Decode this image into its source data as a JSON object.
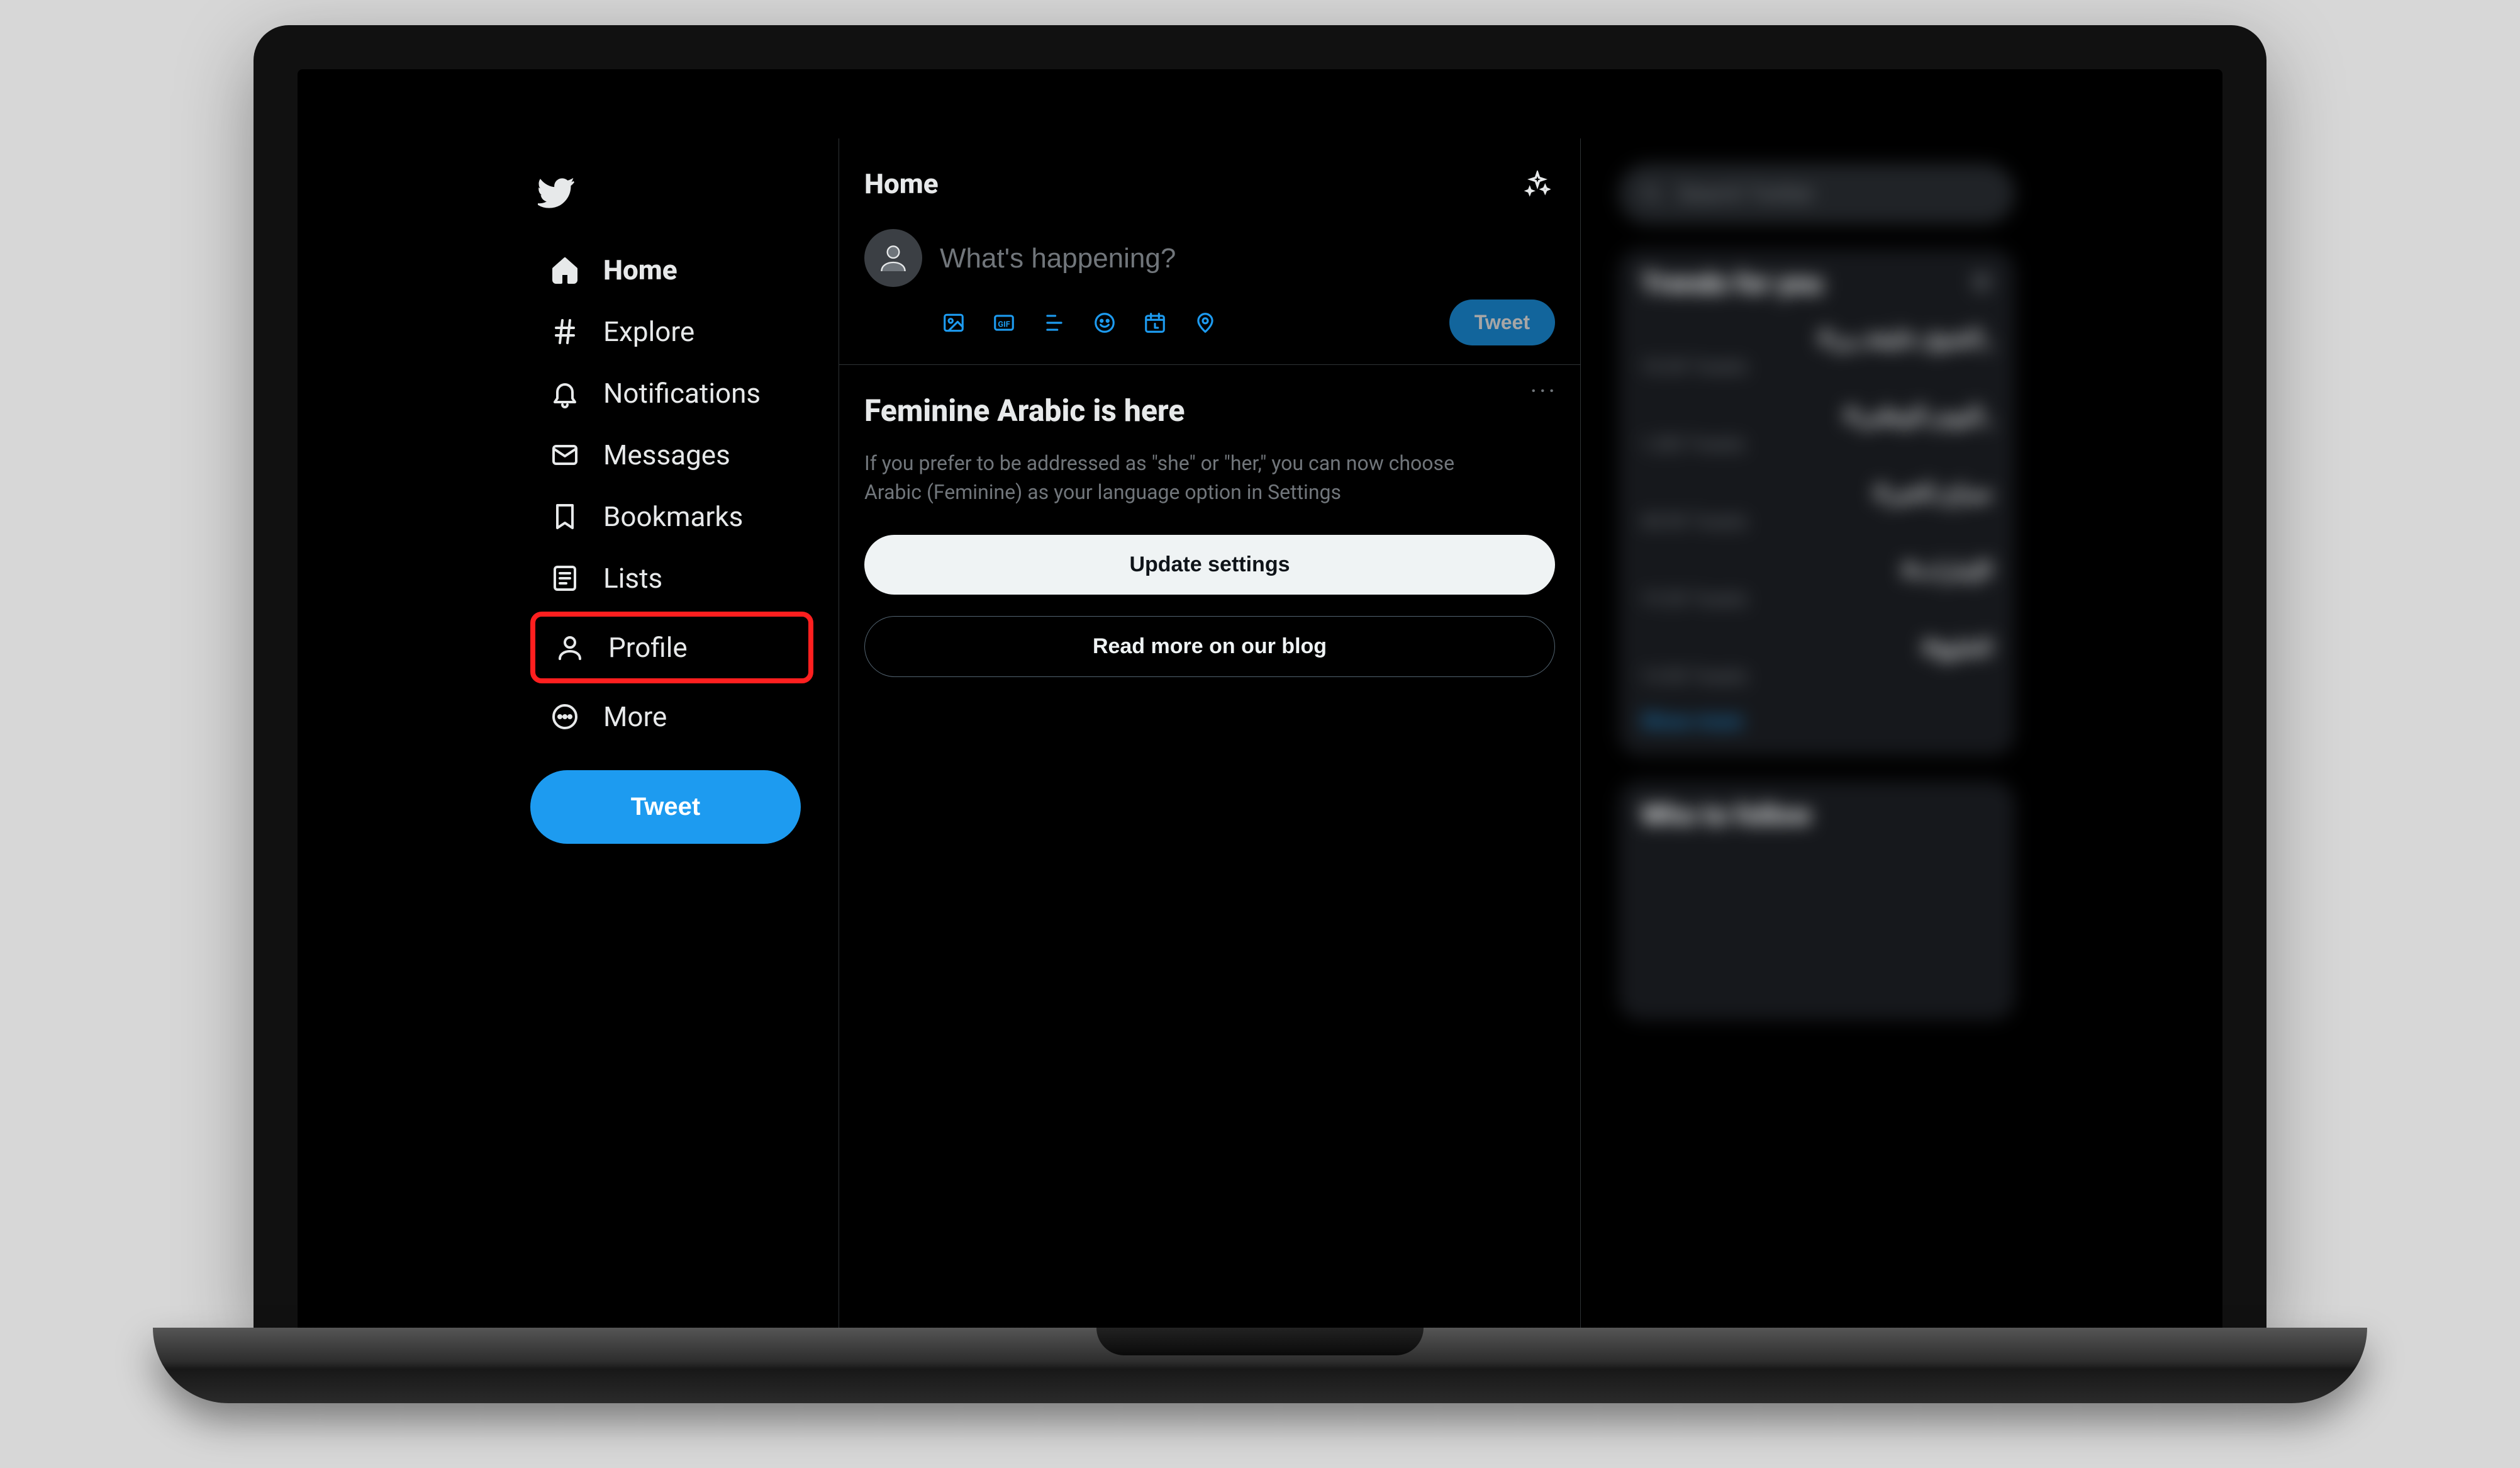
{
  "app": {
    "name": "Twitter"
  },
  "sidebar": {
    "items": [
      {
        "id": "home",
        "label": "Home",
        "icon": "home-icon",
        "active": true
      },
      {
        "id": "explore",
        "label": "Explore",
        "icon": "hashtag-icon",
        "active": false
      },
      {
        "id": "notifications",
        "label": "Notifications",
        "icon": "bell-icon",
        "active": false
      },
      {
        "id": "messages",
        "label": "Messages",
        "icon": "envelope-icon",
        "active": false
      },
      {
        "id": "bookmarks",
        "label": "Bookmarks",
        "icon": "bookmark-icon",
        "active": false
      },
      {
        "id": "lists",
        "label": "Lists",
        "icon": "list-icon",
        "active": false
      },
      {
        "id": "profile",
        "label": "Profile",
        "icon": "person-icon",
        "active": false,
        "highlighted": true
      },
      {
        "id": "more",
        "label": "More",
        "icon": "more-circle-icon",
        "active": false
      }
    ],
    "tweet_button": "Tweet"
  },
  "main": {
    "header_title": "Home",
    "composer": {
      "placeholder": "What's happening?",
      "value": ""
    },
    "compose_icons": [
      "image-icon",
      "gif-icon",
      "poll-icon",
      "emoji-icon",
      "schedule-icon",
      "location-icon"
    ],
    "compose_tweet_label": "Tweet",
    "promo": {
      "title": "Feminine Arabic is here",
      "body": "If you prefer to be addressed as \"she\" or \"her,\" you can now choose Arabic (Feminine) as your language option in Settings",
      "primary_button": "Update settings",
      "secondary_button": "Read more on our blog"
    }
  },
  "right": {
    "search_placeholder": "Search Twitter",
    "trends_title": "Trends for you",
    "trends": [
      {
        "name": "#الشيخ_خليفة_بن_",
        "meta": "18.3K Tweets"
      },
      {
        "name": "#اليوم_الوطني_",
        "meta": "1,282 Tweets"
      },
      {
        "name": "#صباح_الخير",
        "meta": "48.9K Tweets"
      },
      {
        "name": "#الإمارات",
        "meta": "19.3K Tweets"
      },
      {
        "name": "#الخليج",
        "meta": "14.5K Tweets"
      }
    ],
    "show_more": "Show more",
    "who_title": "Who to follow"
  },
  "colors": {
    "accent": "#1d9bf0",
    "highlight": "#ff1f1f",
    "panel": "#16181c"
  }
}
